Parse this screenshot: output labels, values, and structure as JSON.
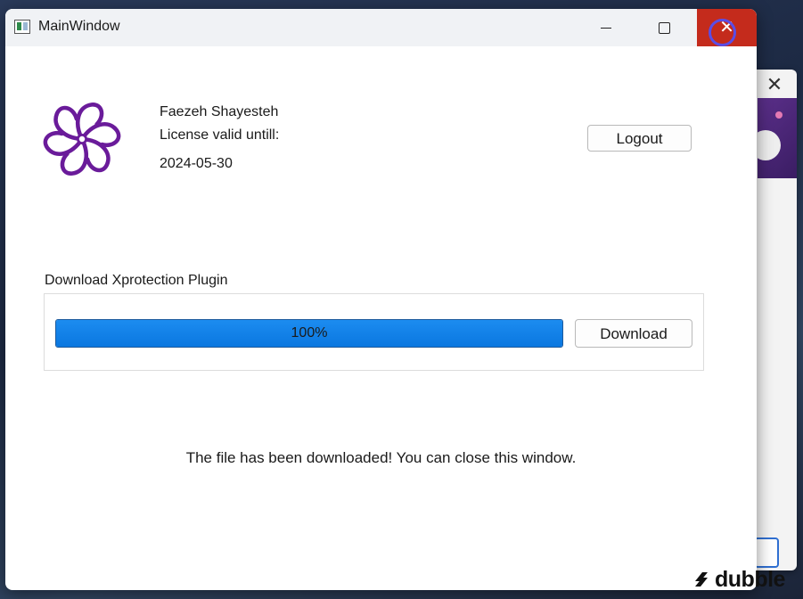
{
  "window": {
    "title": "MainWindow"
  },
  "user": {
    "name": "Faezeh Shayesteh",
    "license_label": "License valid untill:",
    "license_date": "2024-05-30"
  },
  "header": {
    "logout_label": "Logout"
  },
  "download": {
    "section_label": "Download Xprotection Plugin",
    "progress_value": 100,
    "progress_text": "100%",
    "button_label": "Download"
  },
  "status": {
    "message": "The file has been downloaded! You can close this window."
  },
  "watermark": {
    "text": "dubble"
  },
  "colors": {
    "progress_fill": "#0a77e0",
    "close_button": "#c42b1c",
    "logo_purple": "#6a1b9a",
    "cursor_ring": "#5a4de6"
  },
  "icons": {
    "app": "window-app-icon",
    "minimize": "minimize-icon",
    "maximize": "maximize-icon",
    "close": "close-icon",
    "logo": "flower-logo-icon"
  }
}
